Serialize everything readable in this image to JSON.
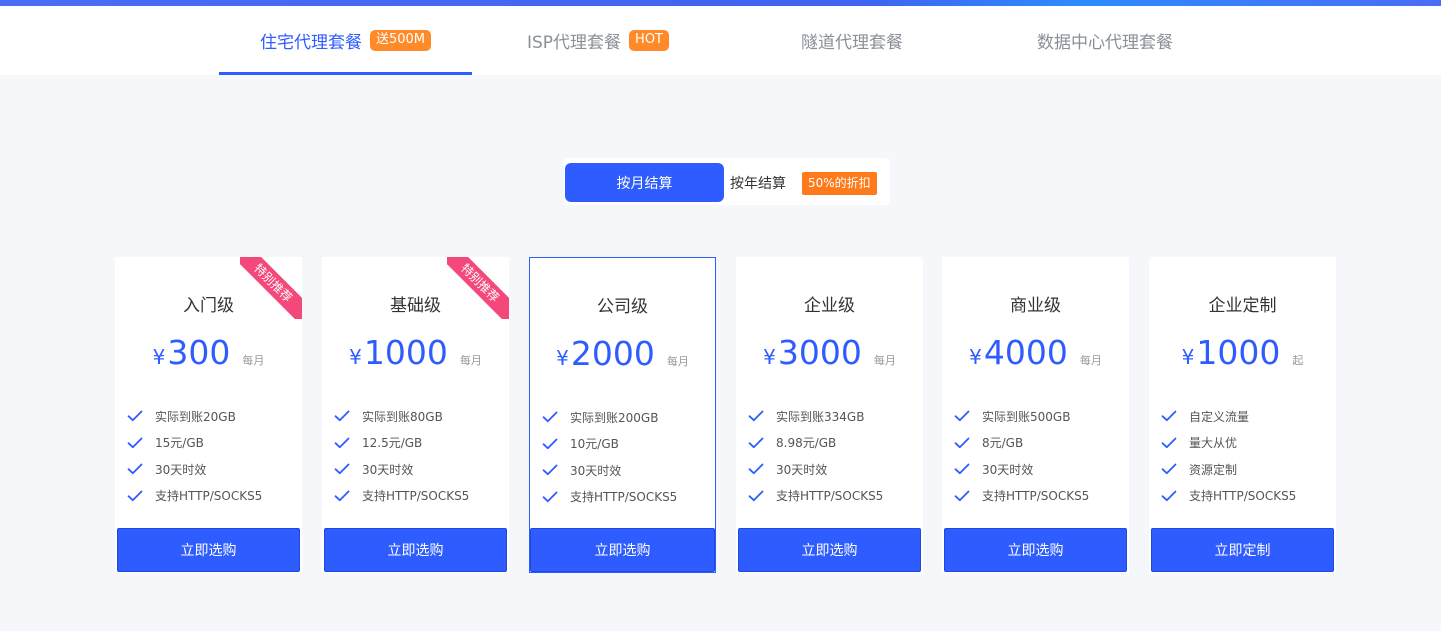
{
  "tabs": [
    {
      "label": "住宅代理套餐",
      "badge": "送500M",
      "active": true
    },
    {
      "label": "ISP代理套餐",
      "badge": "HOT",
      "active": false
    },
    {
      "label": "隧道代理套餐",
      "badge": "",
      "active": false
    },
    {
      "label": "数据中心代理套餐",
      "badge": "",
      "active": false
    }
  ],
  "billing": {
    "monthly": "按月结算",
    "yearly": "按年结算",
    "discount": "50%的折扣"
  },
  "currency": "¥",
  "plans": [
    {
      "name": "入门级",
      "price": "300",
      "unit": "每月",
      "ribbon": "特别推荐",
      "features": [
        "实际到账20GB",
        "15元/GB",
        "30天时效",
        "支持HTTP/SOCKS5"
      ],
      "button": "立即选购"
    },
    {
      "name": "基础级",
      "price": "1000",
      "unit": "每月",
      "ribbon": "特别推荐",
      "features": [
        "实际到账80GB",
        "12.5元/GB",
        "30天时效",
        "支持HTTP/SOCKS5"
      ],
      "button": "立即选购"
    },
    {
      "name": "公司级",
      "price": "2000",
      "unit": "每月",
      "ribbon": "",
      "features": [
        "实际到账200GB",
        "10元/GB",
        "30天时效",
        "支持HTTP/SOCKS5"
      ],
      "button": "立即选购"
    },
    {
      "name": "企业级",
      "price": "3000",
      "unit": "每月",
      "ribbon": "",
      "features": [
        "实际到账334GB",
        "8.98元/GB",
        "30天时效",
        "支持HTTP/SOCKS5"
      ],
      "button": "立即选购"
    },
    {
      "name": "商业级",
      "price": "4000",
      "unit": "每月",
      "ribbon": "",
      "features": [
        "实际到账500GB",
        "8元/GB",
        "30天时效",
        "支持HTTP/SOCKS5"
      ],
      "button": "立即选购"
    },
    {
      "name": "企业定制",
      "price": "1000",
      "unit": "起",
      "ribbon": "",
      "features": [
        "自定义流量",
        "量大从优",
        "资源定制",
        "支持HTTP/SOCKS5"
      ],
      "button": "立即定制"
    }
  ],
  "icons": {
    "check": "check-icon"
  },
  "colors": {
    "accent": "#2f5cff",
    "badge": "#ff8a2a",
    "ribbon": "#f4477a"
  }
}
